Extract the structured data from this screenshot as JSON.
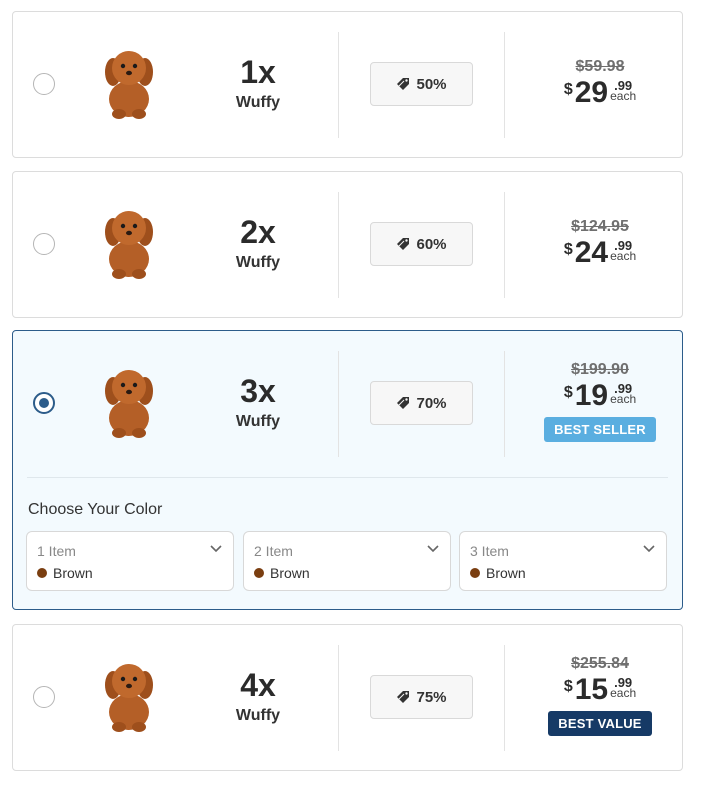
{
  "offers": [
    {
      "qty": "1x",
      "name": "Wuffy",
      "discount": "50%",
      "old_price": "$59.98",
      "currency": "$",
      "whole": "29",
      "cents": ".99",
      "each": "each",
      "badge": "",
      "selected": false
    },
    {
      "qty": "2x",
      "name": "Wuffy",
      "discount": "60%",
      "old_price": "$124.95",
      "currency": "$",
      "whole": "24",
      "cents": ".99",
      "each": "each",
      "badge": "",
      "selected": false
    },
    {
      "qty": "3x",
      "name": "Wuffy",
      "discount": "70%",
      "old_price": "$199.90",
      "currency": "$",
      "whole": "19",
      "cents": ".99",
      "each": "each",
      "badge": "BEST SELLER",
      "selected": true
    },
    {
      "qty": "4x",
      "name": "Wuffy",
      "discount": "75%",
      "old_price": "$255.84",
      "currency": "$",
      "whole": "15",
      "cents": ".99",
      "each": "each",
      "badge": "BEST VALUE",
      "selected": false
    }
  ],
  "color_picker": {
    "title": "Choose Your Color",
    "selects": [
      {
        "label": "1 Item",
        "value": "Brown",
        "swatch": "#7a3e10"
      },
      {
        "label": "2 Item",
        "value": "Brown",
        "swatch": "#7a3e10"
      },
      {
        "label": "3 Item",
        "value": "Brown",
        "swatch": "#7a3e10"
      }
    ]
  },
  "colors": {
    "accent": "#2c5c8a",
    "best_seller_badge": "#5aaee0",
    "best_value_badge": "#163a66",
    "selected_card_bg": "#f3fafe"
  },
  "icons": {
    "discount": "price-tag-icon",
    "select": "chevron-down-icon",
    "product": "puppy-plush-image"
  }
}
